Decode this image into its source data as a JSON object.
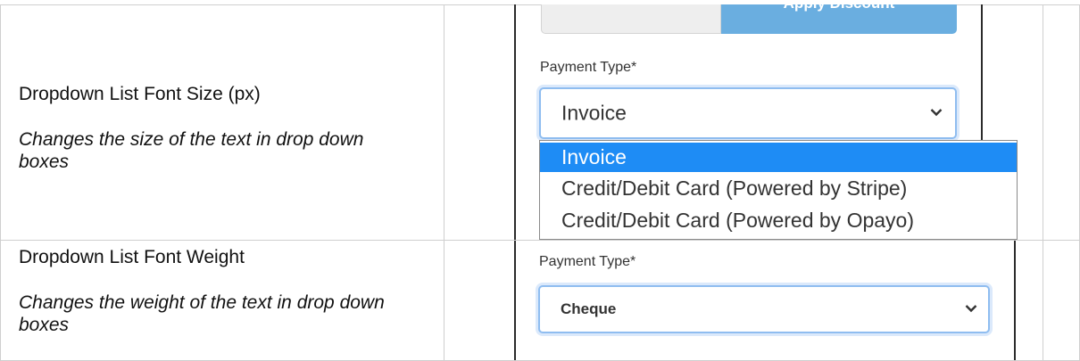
{
  "rows": [
    {
      "setting": "Dropdown List Font Size (px)",
      "description": "Changes the size of the text in drop down boxes",
      "preview": {
        "apply_discount_label": "Apply Discount",
        "field_label": "Payment Type*",
        "selected_value": "Invoice",
        "options": [
          "Invoice",
          "Credit/Debit Card (Powered by Stripe)",
          "Credit/Debit Card (Powered by Opayo)"
        ]
      }
    },
    {
      "setting": "Dropdown List Font Weight",
      "description": "Changes the weight of the text in drop down boxes",
      "preview": {
        "field_label": "Payment Type*",
        "selected_value": "Cheque"
      }
    }
  ],
  "icons": {
    "dropdown": "chevron-down-icon"
  },
  "colors": {
    "selected_option": "#1e8cf5",
    "focus_border": "#8fbdf0",
    "apply_button": "#6aaee0"
  }
}
